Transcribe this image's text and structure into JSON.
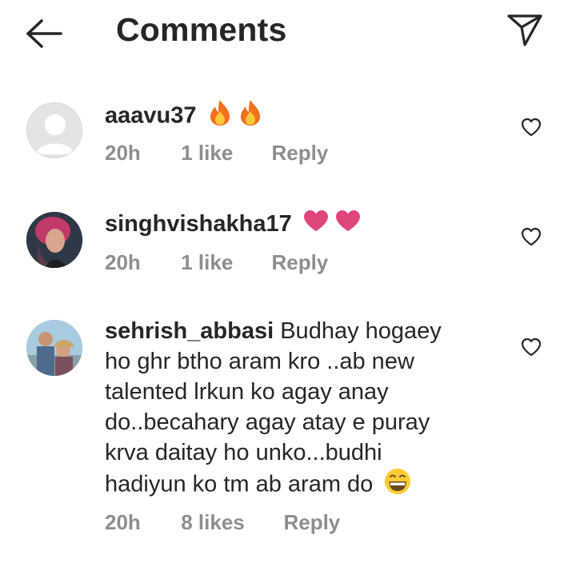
{
  "header": {
    "title": "Comments",
    "back_icon": "arrow-left-icon",
    "send_icon": "paper-plane-icon"
  },
  "comments": [
    {
      "username": "aaavu37",
      "text": "",
      "emoji": [
        "fire",
        "fire"
      ],
      "time": "20h",
      "likes": "1 like",
      "reply": "Reply",
      "avatar": "default-avatar"
    },
    {
      "username": "singhvishakha17",
      "text": "",
      "emoji": [
        "pink-heart",
        "pink-heart"
      ],
      "time": "20h",
      "likes": "1 like",
      "reply": "Reply",
      "avatar": "photo-avatar"
    },
    {
      "username": "sehrish_abbasi",
      "text": "Budhay hogaey ho ghr btho aram kro ..ab new talented lrkun ko agay anay do..becahary agay atay e puray krva daitay ho unko...budhi hadiyun ko tm ab aram do",
      "emoji": [
        "grinning-face"
      ],
      "time": "20h",
      "likes": "8 likes",
      "reply": "Reply",
      "avatar": "photo-avatar"
    }
  ],
  "colors": {
    "text": "#262626",
    "meta": "#8e8e8e",
    "heart_emoji": "#e0457b",
    "fire_outer": "#f2711c",
    "fire_inner": "#ffc93c"
  }
}
